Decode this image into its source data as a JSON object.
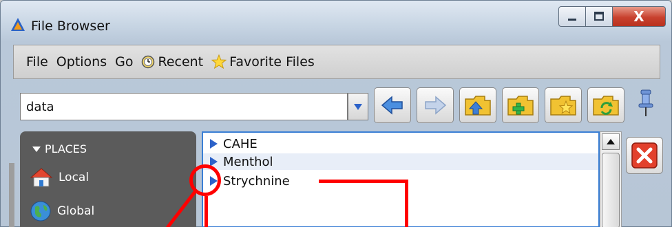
{
  "window": {
    "title": "File Browser",
    "controls": {
      "close_glyph": "X"
    }
  },
  "menu": {
    "file": "File",
    "options": "Options",
    "go": "Go",
    "recent": "Recent",
    "favorites": "Favorite Files"
  },
  "toolbar": {
    "path_value": "data"
  },
  "places": {
    "header": "PLACES",
    "items": [
      {
        "label": "Local",
        "icon": "house-icon"
      },
      {
        "label": "Global",
        "icon": "globe-icon"
      }
    ]
  },
  "files": [
    {
      "name": "CAHE"
    },
    {
      "name": "Menthol"
    },
    {
      "name": "Strychnine"
    }
  ],
  "colors": {
    "selection_border": "#3a7fd5",
    "annotation": "#ff0000",
    "sidebar": "#5b5b5b"
  }
}
